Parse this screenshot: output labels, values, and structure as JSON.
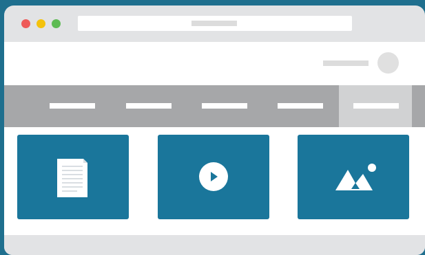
{
  "window": {
    "controls": [
      "close",
      "minimize",
      "maximize"
    ],
    "colors": {
      "close": "#ee5a59",
      "minimize": "#f4c20d",
      "maximize": "#5dbb53",
      "frame": "#e2e3e5",
      "nav": "#a6a7a9",
      "nav_active": "#d1d2d3",
      "card": "#1a769b"
    }
  },
  "nav": {
    "item_count": 5,
    "active_index": 4
  },
  "cards": [
    {
      "icon": "document-icon"
    },
    {
      "icon": "play-icon"
    },
    {
      "icon": "image-icon"
    }
  ]
}
